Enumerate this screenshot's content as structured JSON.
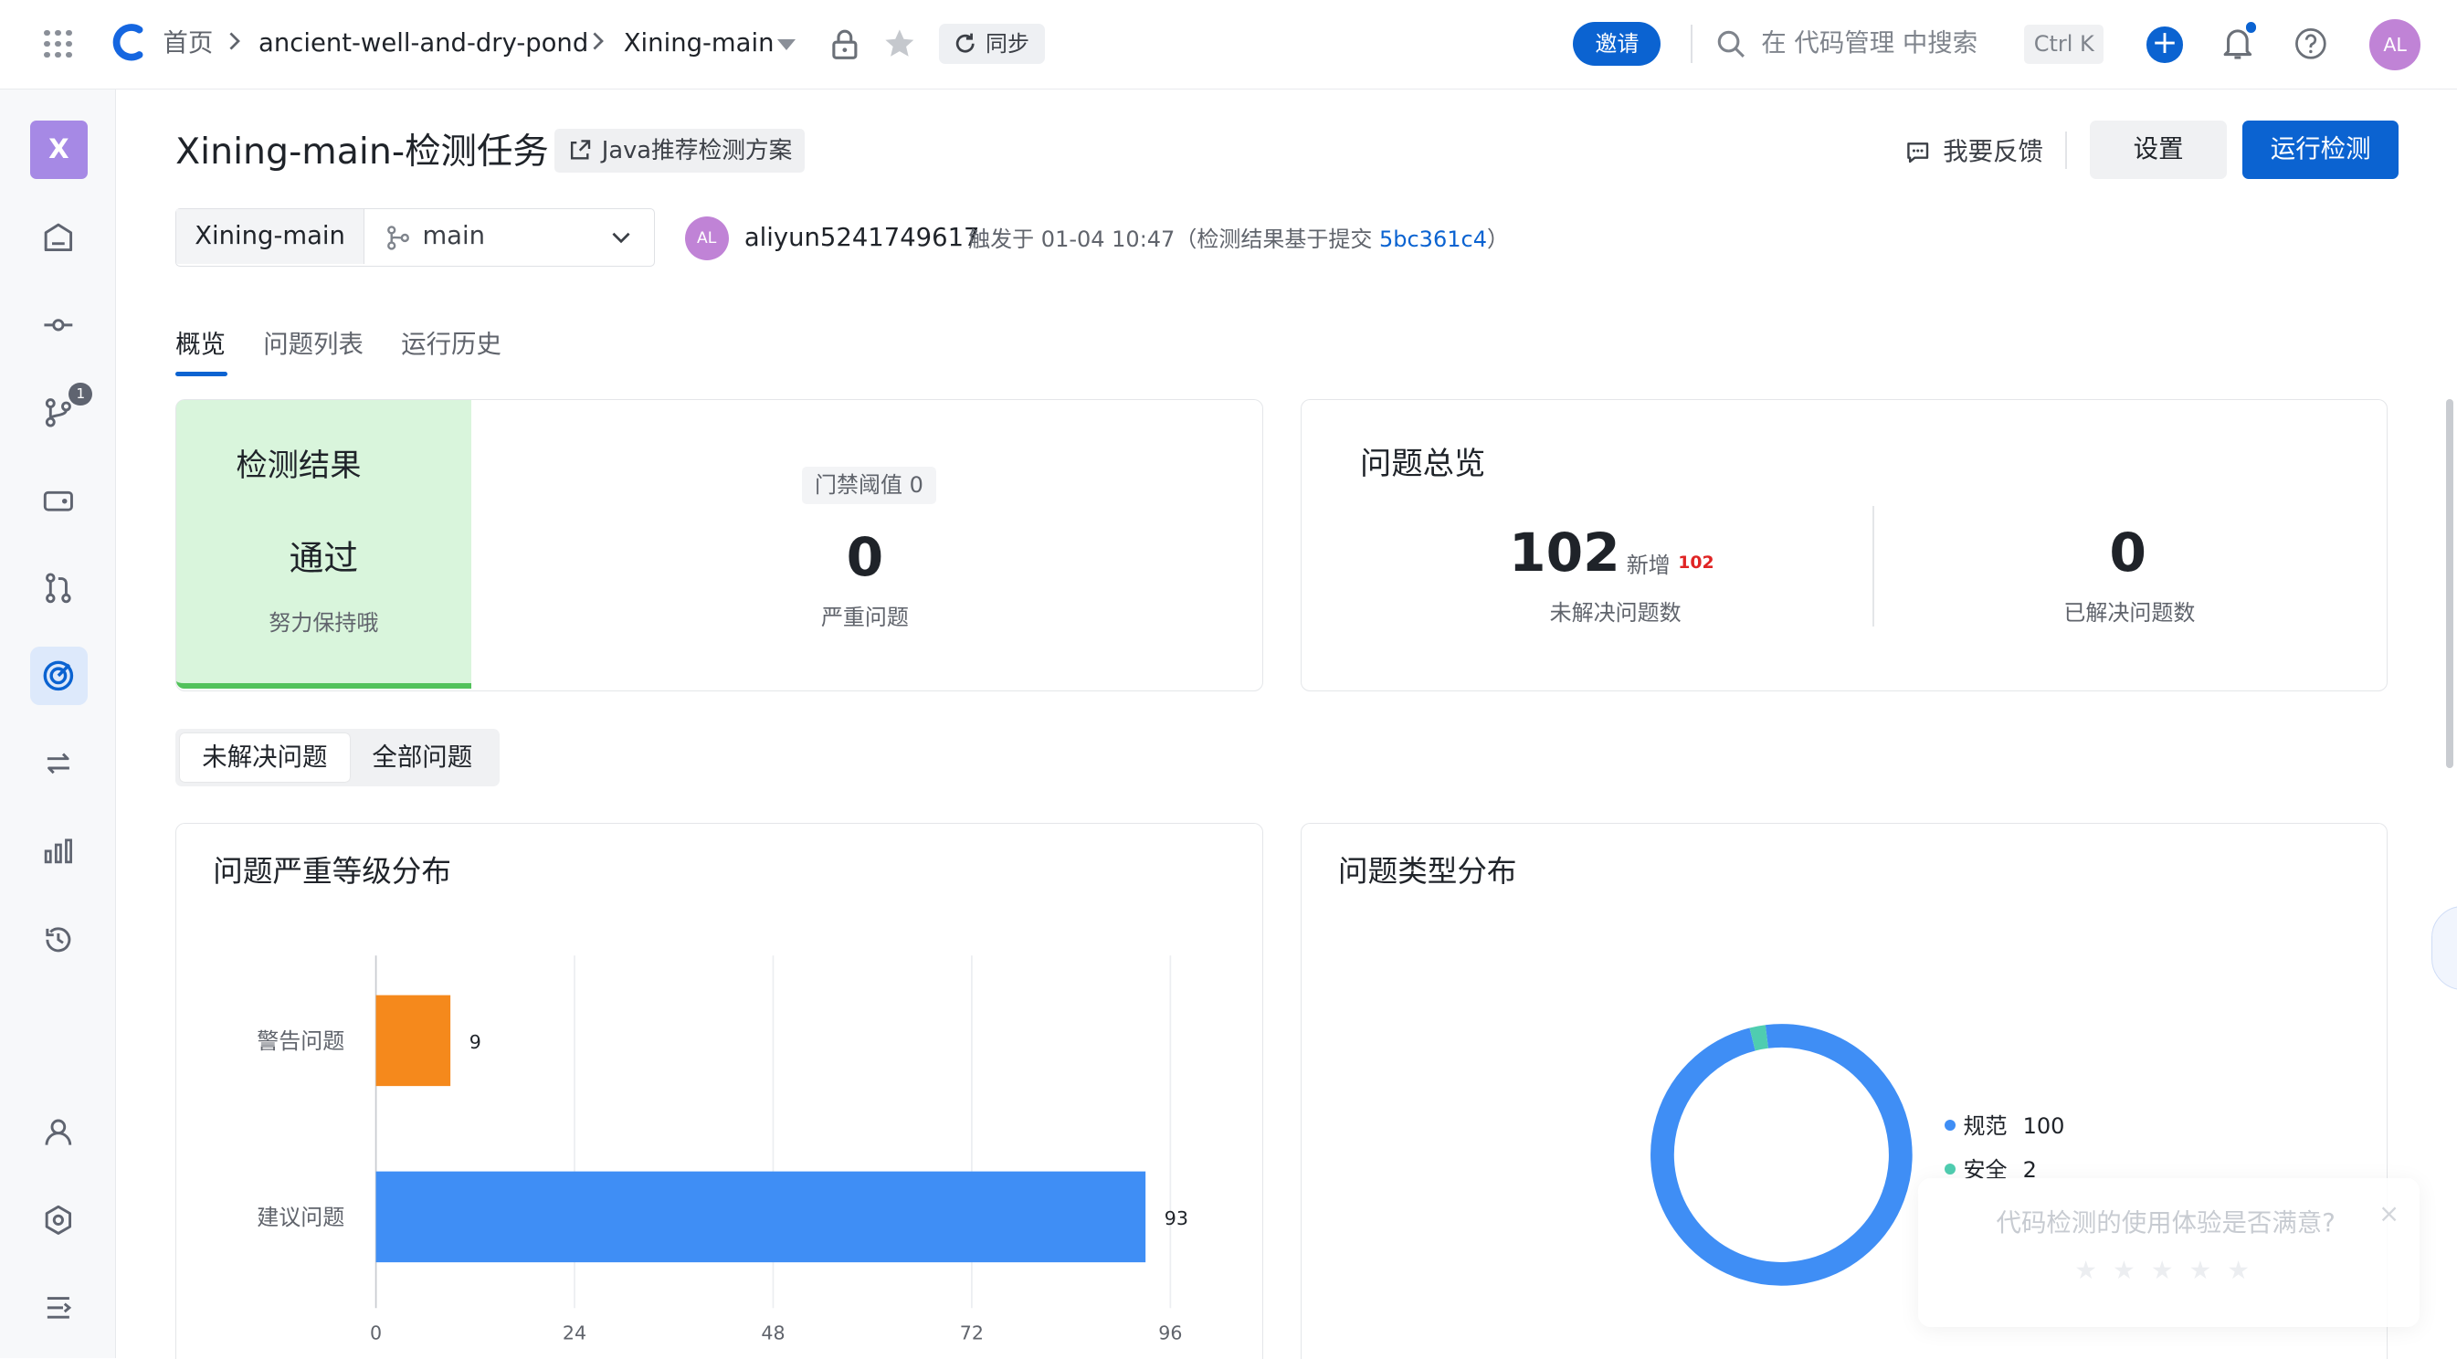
{
  "topbar": {
    "home": "首页",
    "repo": "ancient-well-and-dry-pond",
    "project": "Xining-main",
    "sync": "同步",
    "invite": "邀请",
    "search_placeholder": "在 代码管理 中搜索",
    "shortcut": "Ctrl K",
    "avatar": "AL",
    "accent": "#0b63d1"
  },
  "sidebar": {
    "project_initial": "X",
    "badge": "1",
    "items": [
      "dashboard-icon",
      "commit-icon",
      "branch-icon",
      "tag-icon",
      "merge-request-icon",
      "code-scan-icon",
      "pipeline-icon",
      "stats-icon",
      "history-icon",
      "member-icon",
      "settings-icon",
      "collapse-icon"
    ]
  },
  "header": {
    "title": "Xining-main-检测任务",
    "scheme_tag": "Java推荐检测方案",
    "feedback": "我要反馈",
    "settings": "设置",
    "run": "运行检测"
  },
  "filter": {
    "repo": "Xining-main",
    "branch": "main",
    "user_avatar": "AL",
    "user": "aliyun5241749617",
    "trigger_prefix": "触发于 01-04 10:47（检测结果基于提交",
    "commit": "5bc361c4",
    "trigger_suffix": "）"
  },
  "tabs": [
    "概览",
    "问题列表",
    "运行历史"
  ],
  "result": {
    "title": "检测结果",
    "status": "通过",
    "hint": "努力保持哦",
    "gate": "门禁阈值 0",
    "severe_count": "0",
    "severe_label": "严重问题",
    "status_color": "#52c25b"
  },
  "overview": {
    "title": "问题总览",
    "unresolved": "102",
    "new_label": "新增",
    "new_count": "102",
    "unresolved_label": "未解决问题数",
    "resolved": "0",
    "resolved_label": "已解决问题数"
  },
  "segment": {
    "unresolved": "未解决问题",
    "all": "全部问题"
  },
  "severity_chart": {
    "title": "问题严重等级分布"
  },
  "type_chart": {
    "title": "问题类型分布"
  },
  "chart_data": [
    {
      "type": "bar",
      "orientation": "horizontal",
      "categories": [
        "警告问题",
        "建议问题"
      ],
      "values": [
        9,
        93
      ],
      "colors": [
        "#f5891c",
        "#3f8ef5"
      ],
      "xticks": [
        "0",
        "24",
        "48",
        "72",
        "96"
      ],
      "xlim": [
        0,
        96
      ],
      "grid": true
    },
    {
      "type": "pie",
      "style": "donut",
      "labels": [
        "规范",
        "安全"
      ],
      "values": [
        100,
        2
      ],
      "value_labels": [
        "100",
        "2"
      ],
      "colors": [
        "#3f8ef5",
        "#4fcdb0"
      ],
      "legend": "right"
    }
  ],
  "survey": {
    "question": "代码检测的使用体验是否满意?",
    "close": "×",
    "stars": "★★★★★"
  }
}
